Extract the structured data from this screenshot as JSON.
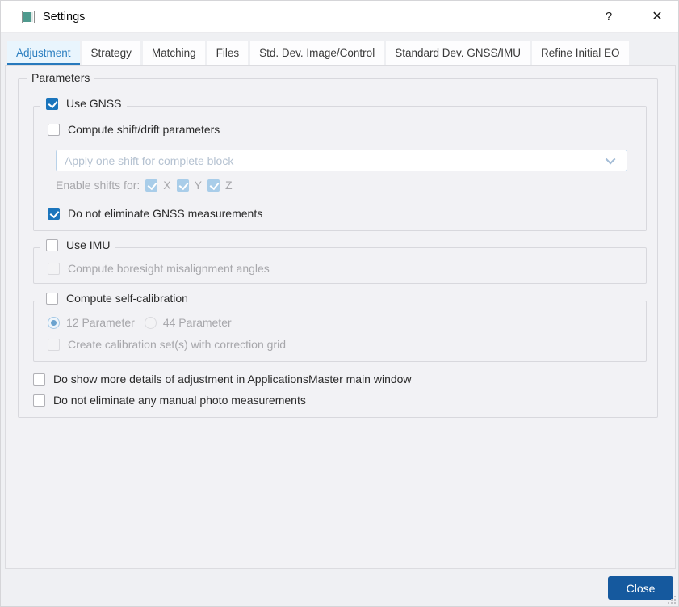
{
  "window": {
    "title": "Settings",
    "help": "?",
    "close": "✕"
  },
  "tabs": [
    {
      "label": "Adjustment",
      "active": true
    },
    {
      "label": "Strategy",
      "active": false
    },
    {
      "label": "Matching",
      "active": false
    },
    {
      "label": "Files",
      "active": false
    },
    {
      "label": "Std. Dev. Image/Control",
      "active": false
    },
    {
      "label": "Standard Dev. GNSS/IMU",
      "active": false
    },
    {
      "label": "Refine Initial EO",
      "active": false
    }
  ],
  "content": {
    "group_label": "Parameters",
    "gnss": {
      "title": "Use GNSS",
      "shift_drift_label": "Compute shift/drift parameters",
      "shift_mode_value": "Apply one shift for complete block",
      "enable_shifts_label": "Enable shifts for:",
      "axis_x": "X",
      "axis_y": "Y",
      "axis_z": "Z",
      "keep_label": "Do not eliminate GNSS measurements"
    },
    "imu": {
      "title": "Use IMU",
      "boresight_label": "Compute boresight misalignment angles"
    },
    "selfcal": {
      "title": "Compute self-calibration",
      "radio12": "12 Parameter",
      "radio44": "44 Parameter",
      "grid_label": "Create calibration set(s) with correction grid"
    },
    "details_label": "Do show more details of adjustment in ApplicationsMaster main window",
    "manual_label": "Do not eliminate any manual photo measurements"
  },
  "state": {
    "use_gnss": true,
    "compute_shift_drift": false,
    "shift_mode_enabled": false,
    "enable_shift_x": true,
    "enable_shift_y": true,
    "enable_shift_z": true,
    "do_not_eliminate_gnss": true,
    "use_imu": false,
    "compute_boresight": false,
    "compute_self_calibration": false,
    "parameter_mode": "12 Parameter",
    "create_calibration_set": false,
    "show_more_details": false,
    "do_not_eliminate_manual": false
  },
  "footer": {
    "close_button": "Close"
  },
  "colors": {
    "accent_checkbox": "#1b75bc",
    "disabled_checkbox": "#a9cde9",
    "active_tab_text": "#2e80c1",
    "active_tab_bg": "#e9f5fd",
    "tab_underline": "#2779bd",
    "close_button_bg": "#15599e",
    "pane_bg": "#f2f2f5"
  }
}
